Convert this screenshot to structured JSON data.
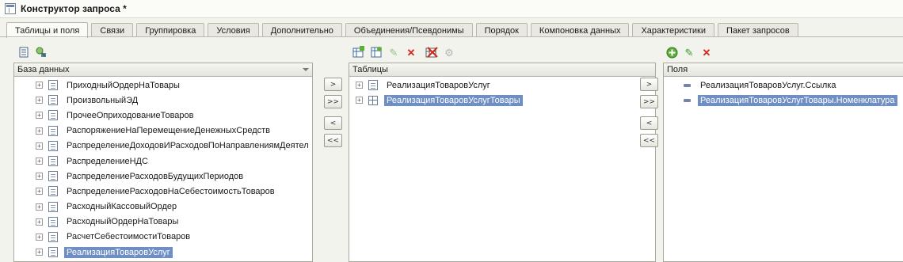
{
  "window": {
    "title": "Конструктор запроса *"
  },
  "tabs": [
    {
      "label": "Таблицы и поля",
      "active": true
    },
    {
      "label": "Связи"
    },
    {
      "label": "Группировка"
    },
    {
      "label": "Условия"
    },
    {
      "label": "Дополнительно"
    },
    {
      "label": "Объединения/Псевдонимы"
    },
    {
      "label": "Порядок"
    },
    {
      "label": "Компоновка данных"
    },
    {
      "label": "Характеристики"
    },
    {
      "label": "Пакет запросов"
    }
  ],
  "database": {
    "header": "База данных",
    "items": [
      "ПриходныйОрдерНаТовары",
      "ПроизвольныйЭД",
      "ПрочееОприходованиеТоваров",
      "РаспоряжениеНаПеремещениеДенежныхСредств",
      "РаспределениеДоходовИРасходовПоНаправлениямДеятел",
      "РаспределениеНДС",
      "РаспределениеРасходовБудущихПериодов",
      "РаспределениеРасходовНаСебестоимостьТоваров",
      "РасходныйКассовыйОрдер",
      "РасходныйОрдерНаТовары",
      "РасчетСебестоимостиТоваров",
      "РеализацияТоваровУслуг"
    ],
    "selected_index": 11
  },
  "tables": {
    "header": "Таблицы",
    "items": [
      {
        "label": "РеализацияТоваровУслуг",
        "icon": "document-icon"
      },
      {
        "label": "РеализацияТоваровУслугТовары",
        "icon": "table-icon",
        "selected": true
      }
    ]
  },
  "fields": {
    "header": "Поля",
    "items": [
      {
        "label": "РеализацияТоваровУслуг.Ссылка"
      },
      {
        "label": "РеализацияТоваровУслугТовары.Номенклатура",
        "selected": true
      }
    ]
  },
  "buttons": {
    "move_one": ">",
    "move_all": ">>",
    "back_one": "<",
    "back_all": "<<"
  },
  "colors": {
    "selection": "#6f8fc4",
    "add_green": "#3a9a2a",
    "delete_red": "#d0281e"
  }
}
